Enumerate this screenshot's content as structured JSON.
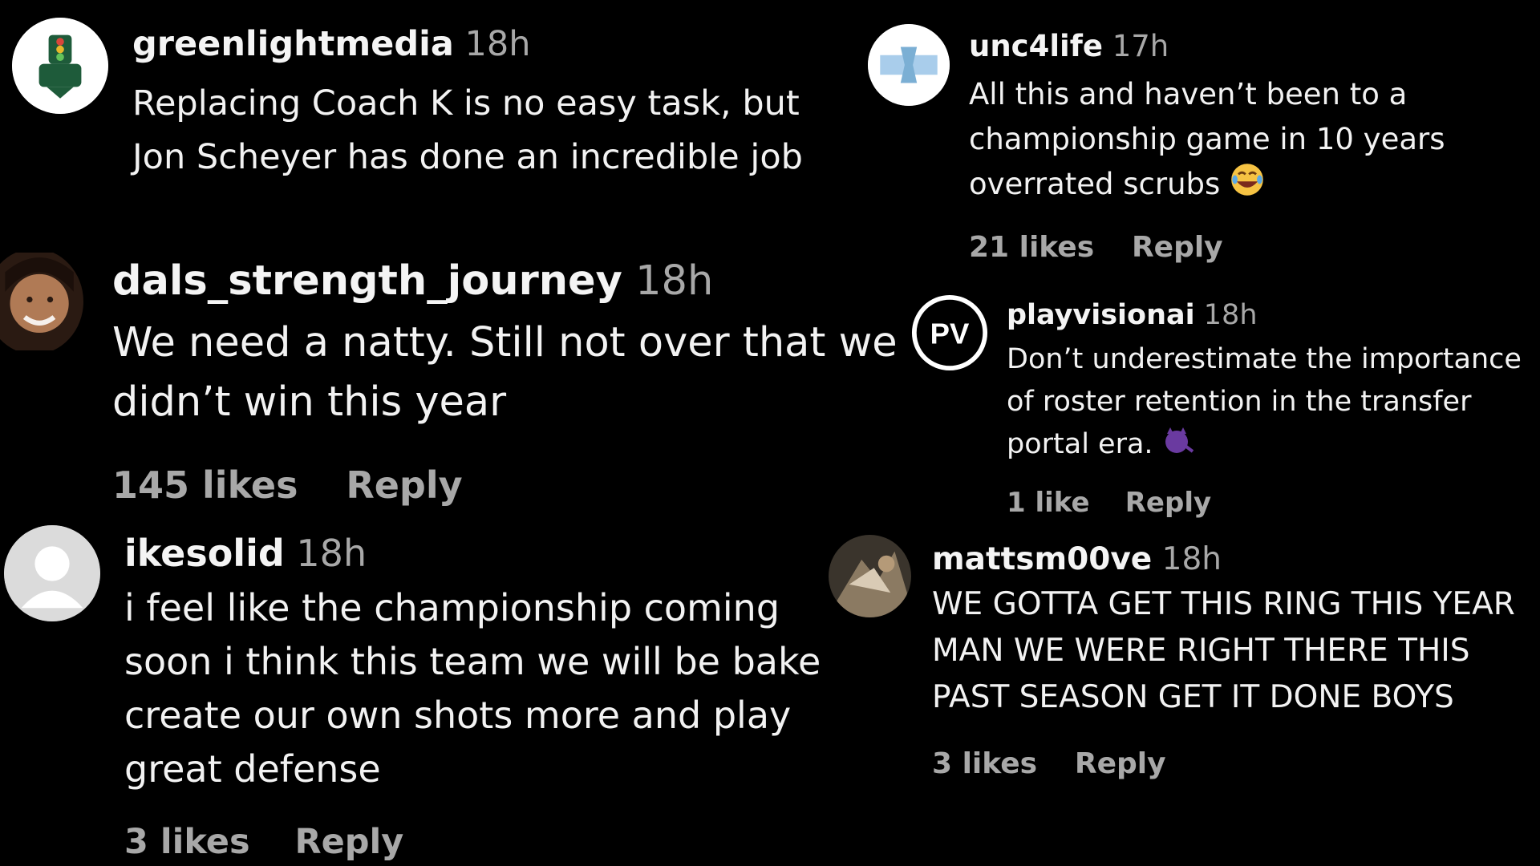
{
  "comments": [
    {
      "username": "greenlightmedia",
      "time": "18h",
      "text": "Replacing Coach K is no easy task, but Jon Scheyer has done an incredible job",
      "avatar": "greenlight-logo-avatar"
    },
    {
      "username": "dals_strength_journey",
      "time": "18h",
      "text": "We need a natty. Still not over that we didn’t win this year",
      "likes": "145 likes",
      "reply": "Reply",
      "avatar": "profile-photo-avatar"
    },
    {
      "username": "ikesolid",
      "time": "18h",
      "text": "i feel like the championship coming soon i think this team we will be bake create our own shots more and play great defense",
      "likes": "3 likes",
      "reply": "Reply",
      "avatar": "default-user-avatar"
    },
    {
      "username": "unc4life",
      "time": "17h",
      "text": "All this and haven’t been to a championship game in 10 years overrated scrubs",
      "emoji": "laughing-crying-emoji",
      "likes": "21 likes",
      "reply": "Reply",
      "avatar": "unc-logo-avatar"
    },
    {
      "username": "playvisionai",
      "time": "18h",
      "text": "Don’t underestimate the importance of roster retention in the transfer portal era.",
      "emoji": "purple-devil-emoji",
      "likes": "1 like",
      "reply": "Reply",
      "avatar": "pv-logo-avatar"
    },
    {
      "username": "mattsm00ve",
      "time": "18h",
      "text": "WE GOTTA GET THIS RING THIS YEAR MAN WE WERE RIGHT THERE THIS PAST SEASON GET IT DONE BOYS",
      "likes": "3 likes",
      "reply": "Reply",
      "avatar": "photo-avatar"
    }
  ],
  "colors": {
    "background": "#000000",
    "text": "#f2f2f2",
    "muted": "#a8a8a8"
  }
}
